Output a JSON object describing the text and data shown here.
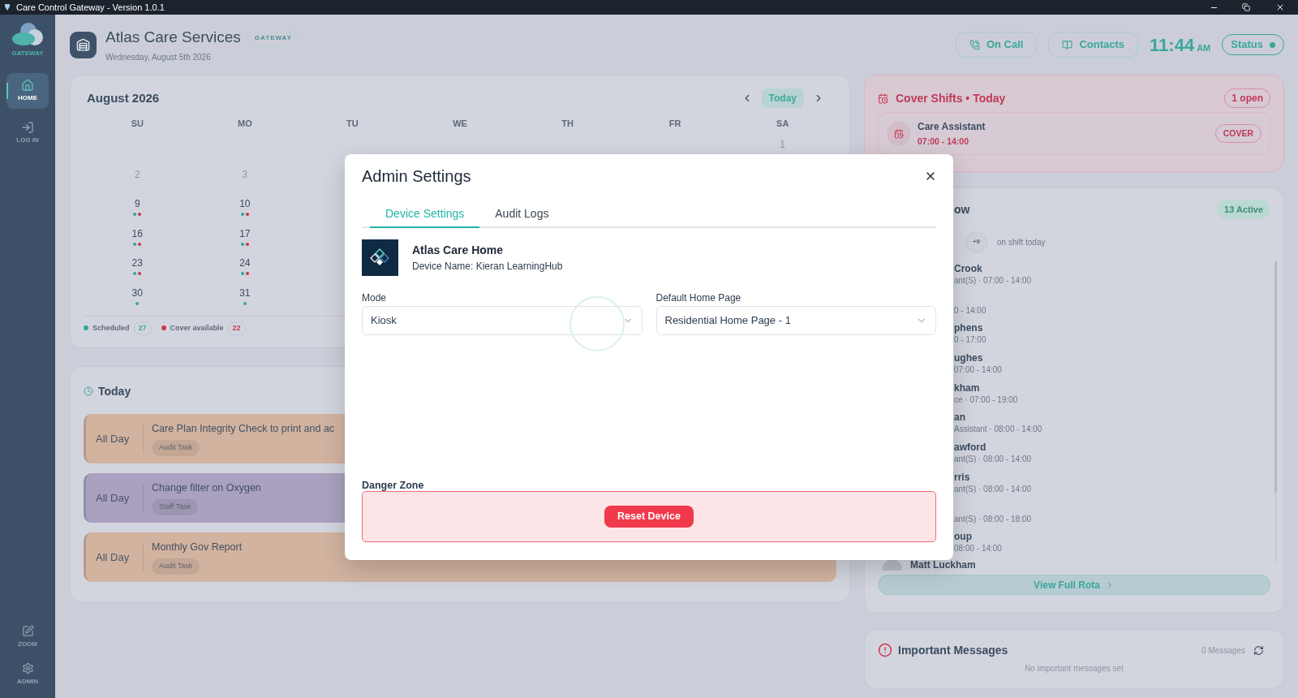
{
  "titlebar": {
    "title": "Care Control Gateway - Version 1.0.1"
  },
  "sidebar": {
    "logo_label": "GATEWAY",
    "items": [
      {
        "label": "HOME",
        "selected": true
      },
      {
        "label": "LOG IN",
        "selected": false
      }
    ],
    "bottom_items": [
      {
        "label": "ZOOM"
      },
      {
        "label": "ADMIN"
      }
    ]
  },
  "header": {
    "title": "Atlas Care Services",
    "badge": "GATEWAY",
    "date": "Wednesday, August 5th 2026",
    "buttons": [
      "On Call",
      "Contacts"
    ],
    "time": "11:44",
    "ampm": "AM",
    "status": "Status"
  },
  "calendar": {
    "month": "August 2026",
    "today_button": "Today",
    "weekdays": [
      "SU",
      "MO",
      "TU",
      "WE",
      "TH",
      "FR",
      "SA"
    ],
    "days": [
      {
        "day": "1",
        "muted": true,
        "scheduled": false,
        "cover": false
      },
      {
        "day": "2",
        "muted": true,
        "scheduled": false,
        "cover": false
      },
      {
        "day": "3",
        "muted": true,
        "scheduled": false,
        "cover": false
      },
      {
        "day": "9",
        "muted": false,
        "scheduled": true,
        "cover": true
      },
      {
        "day": "10",
        "muted": false,
        "scheduled": true,
        "cover": true
      },
      {
        "day": "16",
        "muted": false,
        "scheduled": true,
        "cover": true
      },
      {
        "day": "17",
        "muted": false,
        "scheduled": true,
        "cover": true
      },
      {
        "day": "23",
        "muted": false,
        "scheduled": true,
        "cover": true
      },
      {
        "day": "24",
        "muted": false,
        "scheduled": true,
        "cover": true
      },
      {
        "day": "30",
        "muted": false,
        "scheduled": true,
        "cover": false
      },
      {
        "day": "31",
        "muted": false,
        "scheduled": true,
        "cover": false
      }
    ],
    "legend": [
      {
        "label": "Scheduled",
        "count": "27",
        "color": "#2fa89b"
      },
      {
        "label": "Cover available",
        "count": "22",
        "color": "#c9364f"
      }
    ]
  },
  "today": {
    "title": "Today",
    "tasks": [
      {
        "time": "All Day",
        "title": "Care Plan Integrity Check to print and ac",
        "tag": "Audit Task",
        "color": "#d2b3a0"
      },
      {
        "time": "All Day",
        "title": "Change filter on Oxygen",
        "tag": "Staff Task",
        "color": "#a9a1bf"
      },
      {
        "time": "All Day",
        "title": "Monthly Gov Report",
        "tag": "Audit Task",
        "color": "#d2b3a0"
      }
    ]
  },
  "cover_shifts": {
    "title": "Cover Shifts • Today",
    "count": "1 open",
    "shifts": [
      {
        "role": "Care Assistant",
        "time": "07:00 - 14:00",
        "badge": "COVER"
      }
    ]
  },
  "rota": {
    "title": "ow",
    "active": "13 Active",
    "more": "+9",
    "on_shift": "on shift today",
    "staff": [
      {
        "name": "Crook",
        "detail": "ant(S) · 07:00 - 14:00"
      },
      {
        "detail": "0 - 14:00"
      },
      {
        "name": "phens",
        "detail": "0 - 17:00"
      },
      {
        "name": "ughes",
        "detail": "07:00 - 14:00"
      },
      {
        "name": "kham",
        "detail": "ce · 07:00 - 19:00"
      },
      {
        "name": "an",
        "detail": "Assistant · 08:00 - 14:00"
      },
      {
        "name": "awford",
        "detail": "ant(S) · 08:00 - 14:00"
      },
      {
        "name": "rris",
        "detail": "ant(S) · 08:00 - 14:00"
      },
      {
        "detail": "ant(S) · 08:00 - 18:00"
      },
      {
        "name": "oup",
        "detail": "08:00 - 14:00"
      }
    ],
    "last": {
      "name": "Matt Luckham"
    },
    "button": "View Full Rota"
  },
  "messages": {
    "title": "Important Messages",
    "count": "0 Messages",
    "empty": "No important messages set"
  },
  "modal": {
    "title": "Admin Settings",
    "tabs": [
      {
        "label": "Device Settings",
        "selected": true
      },
      {
        "label": "Audit Logs",
        "selected": false
      }
    ],
    "device": {
      "name": "Atlas Care Home",
      "device_name": "Device Name: Kieran LearningHub"
    },
    "fields": [
      {
        "label": "Mode",
        "value": "Kiosk"
      },
      {
        "label": "Default Home Page",
        "value": "Residential Home Page - 1"
      }
    ],
    "danger": {
      "label": "Danger Zone",
      "button": "Reset Device"
    }
  }
}
